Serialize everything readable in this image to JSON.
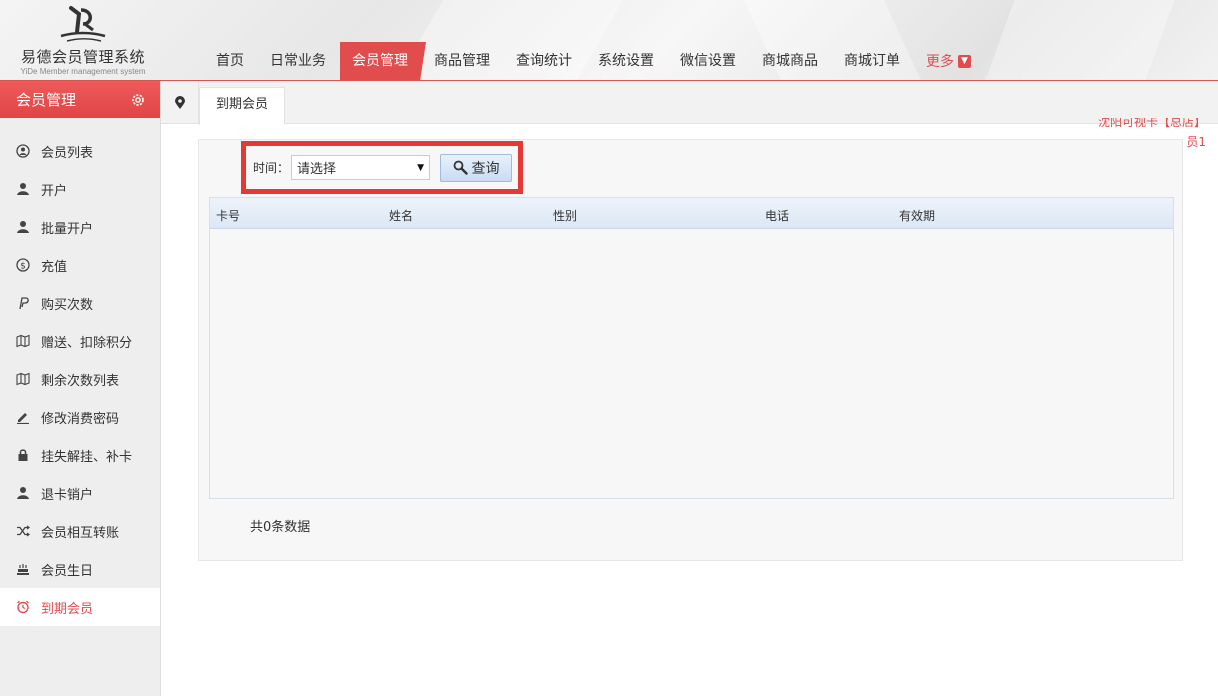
{
  "app": {
    "name": "易德会员管理系统",
    "subtitle": "YiDe Member management system"
  },
  "nav": {
    "items": [
      {
        "label": "首页"
      },
      {
        "label": "日常业务"
      },
      {
        "label": "会员管理",
        "active": true
      },
      {
        "label": "商品管理"
      },
      {
        "label": "查询统计"
      },
      {
        "label": "系统设置"
      },
      {
        "label": "微信设置"
      },
      {
        "label": "商城商品"
      },
      {
        "label": "商城订单"
      }
    ],
    "more_label": "更多"
  },
  "sidebar": {
    "title": "会员管理",
    "items": [
      {
        "label": "会员列表",
        "icon": "user-circle-icon"
      },
      {
        "label": "开户",
        "icon": "user-icon"
      },
      {
        "label": "批量开户",
        "icon": "user-icon"
      },
      {
        "label": "充值",
        "icon": "coin-icon"
      },
      {
        "label": "购买次数",
        "icon": "paypal-icon"
      },
      {
        "label": "赠送、扣除积分",
        "icon": "map-icon"
      },
      {
        "label": "剩余次数列表",
        "icon": "map-icon"
      },
      {
        "label": "修改消费密码",
        "icon": "pencil-icon"
      },
      {
        "label": "挂失解挂、补卡",
        "icon": "lock-icon"
      },
      {
        "label": "退卡销户",
        "icon": "user-icon"
      },
      {
        "label": "会员相互转账",
        "icon": "shuffle-icon"
      },
      {
        "label": "会员生日",
        "icon": "cake-icon"
      },
      {
        "label": "到期会员",
        "icon": "alarm-icon",
        "active": true
      }
    ]
  },
  "tabs": {
    "current": "到期会员"
  },
  "topright": {
    "line1": "沈阳可视卡【总店】",
    "line2": "员1"
  },
  "query": {
    "time_label": "时间：",
    "select_value": "请选择",
    "search_label": "查询"
  },
  "grid": {
    "columns": [
      "卡号",
      "姓名",
      "性别",
      "电话",
      "有效期"
    ],
    "rows": []
  },
  "footer": {
    "total_text": "共0条数据"
  },
  "colors": {
    "accent": "#e14d4d",
    "highlight_box": "#e53935",
    "grid_header": "#dce7f5"
  }
}
